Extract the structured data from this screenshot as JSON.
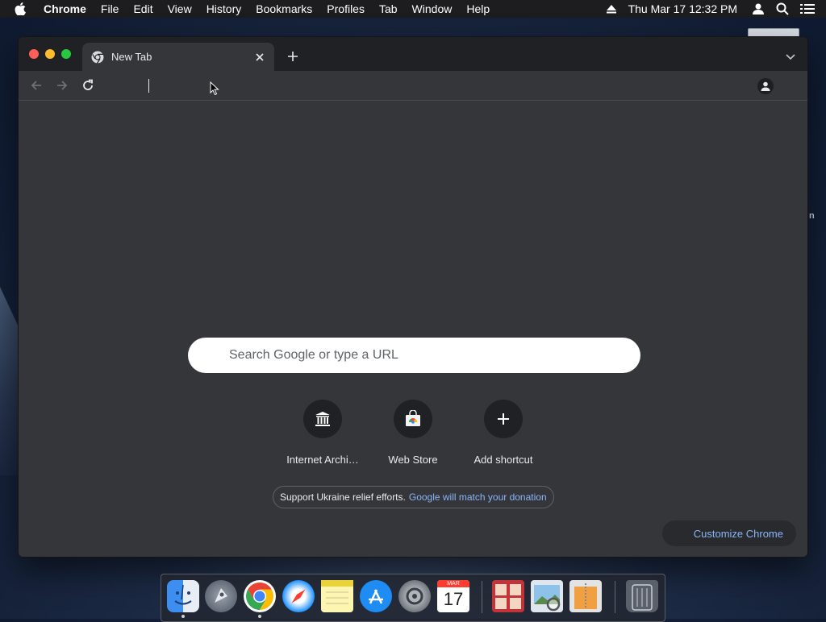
{
  "menubar": {
    "app_name": "Chrome",
    "items": [
      "File",
      "Edit",
      "View",
      "History",
      "Bookmarks",
      "Profiles",
      "Tab",
      "Window",
      "Help"
    ],
    "clock": "Thu Mar 17  12:32 PM",
    "icons": [
      "apple-icon",
      "eject-icon",
      "user-icon",
      "spotlight-icon",
      "control-center-icon"
    ]
  },
  "browser": {
    "tab": {
      "title": "New Tab",
      "favicon": "chrome-icon"
    },
    "toolbar": {
      "omnibox_value": ""
    }
  },
  "ntp": {
    "search_placeholder": "Search Google or type a URL",
    "shortcuts": [
      {
        "label": "Internet Archi…",
        "icon": "archive-icon"
      },
      {
        "label": "Web Store",
        "icon": "webstore-icon"
      },
      {
        "label": "Add shortcut",
        "icon": "plus-icon"
      }
    ],
    "promo_text": "Support Ukraine relief efforts.",
    "promo_link": "Google will match your donation",
    "customize_label": "Customize Chrome"
  },
  "desktop": {
    "partial_label": "n"
  },
  "dock": {
    "apps": [
      "Finder",
      "Launchpad",
      "Google Chrome",
      "Safari",
      "Notes",
      "App Store",
      "System Preferences",
      "Calendar",
      "Photo Booth",
      "Preview",
      "Archive Utility",
      "Trash"
    ],
    "calendar_month": "MAR",
    "calendar_day": "17"
  },
  "colors": {
    "window_bg": "#35363a",
    "titlebar": "#202124",
    "link_blue": "#8ab4f8"
  }
}
